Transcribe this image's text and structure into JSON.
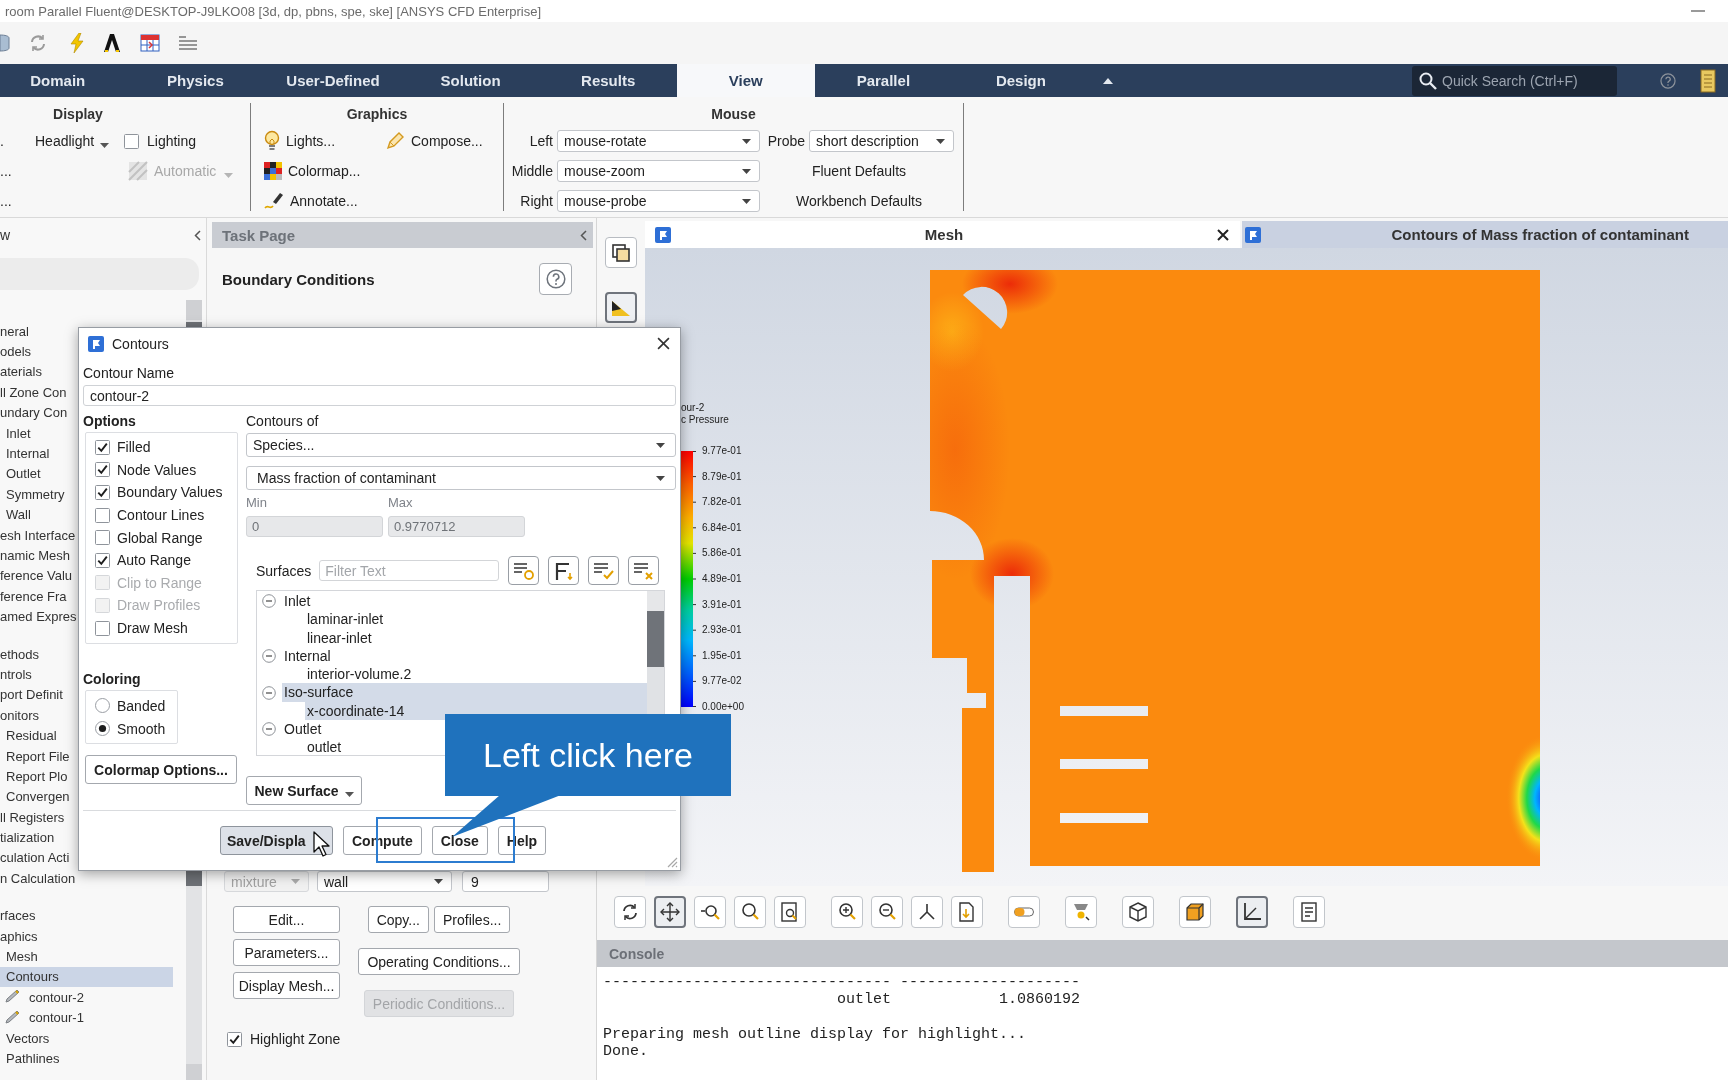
{
  "window": {
    "title": "room Parallel Fluent@DESKTOP-J9LKO08 [3d, dp, pbns, spe, ske] [ANSYS CFD Enterprise]"
  },
  "ribbon": {
    "tabs": [
      {
        "label": "Domain",
        "selected": false
      },
      {
        "label": "Physics",
        "selected": false
      },
      {
        "label": "User-Defined",
        "selected": false
      },
      {
        "label": "Solution",
        "selected": false
      },
      {
        "label": "Results",
        "selected": false
      },
      {
        "label": "View",
        "selected": true
      },
      {
        "label": "Parallel",
        "selected": false
      },
      {
        "label": "Design",
        "selected": false
      }
    ],
    "search": {
      "placeholder": "Quick Search (Ctrl+F)"
    },
    "display_group": {
      "title": "Display",
      "cut_labels": [
        ".",
        "...",
        "..."
      ],
      "headlight": "Headlight",
      "lighting": {
        "label": "Lighting",
        "checked": false
      },
      "automatic": {
        "label": "Automatic",
        "disabled": true
      }
    },
    "graphics_group": {
      "title": "Graphics",
      "buttons": [
        "Lights...",
        "Compose...",
        "Colormap...",
        "Annotate..."
      ]
    },
    "mouse_group": {
      "title": "Mouse",
      "bindings": [
        {
          "button": "Left",
          "action": "mouse-rotate"
        },
        {
          "button": "Middle",
          "action": "mouse-zoom"
        },
        {
          "button": "Right",
          "action": "mouse-probe"
        }
      ],
      "probe": {
        "label": "Probe",
        "value": "short description"
      },
      "defaults": [
        "Fluent Defaults",
        "Workbench Defaults"
      ]
    }
  },
  "outline": {
    "header": "w",
    "sections": [
      {
        "items": [
          {
            "label": "neral",
            "selected": false
          },
          {
            "label": "odels",
            "selected": false
          },
          {
            "label": "aterials",
            "selected": false
          },
          {
            "label": "ll Zone Con",
            "selected": false
          },
          {
            "label": "undary Con",
            "selected": false,
            "children": [
              {
                "label": "Inlet",
                "selected": false
              },
              {
                "label": "Internal",
                "selected": false
              },
              {
                "label": "Outlet",
                "selected": false
              },
              {
                "label": "Symmetry",
                "selected": false
              },
              {
                "label": "Wall",
                "selected": false
              }
            ]
          },
          {
            "label": "esh Interface",
            "selected": false
          },
          {
            "label": "namic Mesh",
            "selected": false
          },
          {
            "label": "ference Valu",
            "selected": false
          },
          {
            "label": "ference Fra",
            "selected": false
          },
          {
            "label": "amed Expres",
            "selected": false
          }
        ]
      },
      {
        "items": [
          {
            "label": "ethods",
            "selected": false
          },
          {
            "label": "ntrols",
            "selected": false
          },
          {
            "label": "port Definit",
            "selected": false
          },
          {
            "label": "onitors",
            "selected": false,
            "children": [
              {
                "label": "Residual",
                "selected": false
              },
              {
                "label": "Report File",
                "selected": false
              },
              {
                "label": "Report Plo",
                "selected": false
              },
              {
                "label": "Convergen",
                "selected": false
              }
            ]
          },
          {
            "label": "ll Registers",
            "selected": false
          },
          {
            "label": "tialization",
            "selected": false
          },
          {
            "label": "culation Acti",
            "selected": false
          },
          {
            "label": "n Calculation",
            "selected": false
          }
        ]
      },
      {
        "items": [
          {
            "label": "rfaces",
            "selected": false
          },
          {
            "label": "aphics",
            "selected": false,
            "children": [
              {
                "label": "Mesh",
                "selected": false
              },
              {
                "label": "Contours",
                "selected": true,
                "children": [
                  {
                    "label": "contour-2",
                    "selected": false
                  },
                  {
                    "label": "contour-1",
                    "selected": false
                  }
                ]
              },
              {
                "label": "Vectors",
                "selected": false
              },
              {
                "label": "Pathlines",
                "selected": false
              }
            ]
          }
        ]
      }
    ]
  },
  "task_page": {
    "header": "Task Page",
    "title": "Boundary Conditions",
    "zone_row": [
      {
        "kind": "dropdown",
        "value": "mixture",
        "disabled": true
      },
      {
        "kind": "dropdown",
        "value": "wall",
        "disabled": false
      },
      {
        "kind": "field",
        "value": "9",
        "disabled": false
      }
    ],
    "left_buttons": [
      {
        "label": "Edit...",
        "disabled": false
      },
      {
        "label": "Parameters...",
        "disabled": false
      },
      {
        "label": "Display Mesh...",
        "disabled": false
      }
    ],
    "right_buttons": [
      {
        "label": "Copy...",
        "disabled": false
      },
      {
        "label": "Profiles...",
        "disabled": false
      },
      {
        "label": "Operating Conditions...",
        "disabled": false
      },
      {
        "label": "Periodic Conditions...",
        "disabled": true
      }
    ],
    "highlight_zone": {
      "label": "Highlight Zone",
      "checked": true
    }
  },
  "side_toolbar": [
    {
      "selected": false
    },
    {
      "selected": true
    }
  ],
  "graphics": {
    "windows": [
      {
        "title": "Mesh",
        "selected": true
      },
      {
        "title": "Contours of Mass fraction of contaminant",
        "selected": false
      }
    ],
    "legend": {
      "title": [
        "our-2",
        "c Pressure"
      ],
      "labels": [
        "9.77e-01",
        "8.79e-01",
        "7.82e-01",
        "6.84e-01",
        "5.86e-01",
        "4.89e-01",
        "3.91e-01",
        "2.93e-01",
        "1.95e-01",
        "9.77e-02",
        "0.00e+00"
      ]
    }
  },
  "view_toolbar": [
    {
      "selected": false
    },
    {
      "selected": true
    },
    {
      "selected": false
    },
    {
      "selected": false
    },
    {
      "selected": false
    },
    {
      "selected": false
    },
    {
      "selected": false
    },
    {
      "selected": false
    },
    {
      "selected": false
    },
    {
      "selected": false
    },
    {
      "selected": false
    },
    {
      "selected": false
    },
    {
      "selected": false
    },
    {
      "selected": true
    },
    {
      "selected": false
    }
  ],
  "console": {
    "title": "Console",
    "blocks": [
      [
        "-------------------------------- --------------------",
        "                          outlet            1.0860192"
      ],
      [
        "Preparing mesh outline display for highlight...",
        "Done."
      ]
    ]
  },
  "contours_dialog": {
    "title": "Contours",
    "contour_name": {
      "label": "Contour Name",
      "value": "contour-2"
    },
    "options": {
      "title": "Options",
      "items": [
        {
          "label": "Filled",
          "checked": true,
          "disabled": false
        },
        {
          "label": "Node Values",
          "checked": true,
          "disabled": false
        },
        {
          "label": "Boundary Values",
          "checked": true,
          "disabled": false
        },
        {
          "label": "Contour Lines",
          "checked": false,
          "disabled": false
        },
        {
          "label": "Global Range",
          "checked": false,
          "disabled": false
        },
        {
          "label": "Auto Range",
          "checked": true,
          "disabled": false
        },
        {
          "label": "Clip to Range",
          "checked": false,
          "disabled": true
        },
        {
          "label": "Draw Profiles",
          "checked": false,
          "disabled": true
        },
        {
          "label": "Draw Mesh",
          "checked": false,
          "disabled": false
        }
      ]
    },
    "contours_of": {
      "label": "Contours of",
      "category": "Species...",
      "quantity": "Mass fraction of contaminant"
    },
    "range": [
      {
        "label": "Min",
        "value": "0",
        "disabled": true
      },
      {
        "label": "Max",
        "value": "0.9770712",
        "disabled": true
      }
    ],
    "surfaces": {
      "label": "Surfaces",
      "filter": {
        "placeholder": "Filter Text"
      },
      "tree": [
        {
          "label": "Inlet",
          "expanded": true,
          "selected": false,
          "children": [
            {
              "label": "laminar-inlet",
              "selected": false
            },
            {
              "label": "linear-inlet",
              "selected": false
            }
          ]
        },
        {
          "label": "Internal",
          "expanded": true,
          "selected": false,
          "children": [
            {
              "label": "interior-volume.2",
              "selected": false
            }
          ]
        },
        {
          "label": "Iso-surface",
          "expanded": true,
          "selected": true,
          "children": [
            {
              "label": "x-coordinate-14",
              "selected": true
            }
          ]
        },
        {
          "label": "Outlet",
          "expanded": true,
          "selected": false,
          "children": [
            {
              "label": "outlet",
              "selected": false
            }
          ]
        }
      ]
    },
    "coloring": {
      "title": "Coloring",
      "options": [
        {
          "label": "Banded",
          "selected": false
        },
        {
          "label": "Smooth",
          "selected": true
        }
      ]
    },
    "colormap_button": "Colormap Options...",
    "new_surface": "New Surface",
    "buttons": [
      {
        "label": "Save/Displa",
        "selected": true
      },
      {
        "label": "Compute",
        "selected": false
      },
      {
        "label": "Close",
        "selected": false
      },
      {
        "label": "Help",
        "selected": false
      }
    ]
  },
  "callout": {
    "text": "Left click here"
  }
}
